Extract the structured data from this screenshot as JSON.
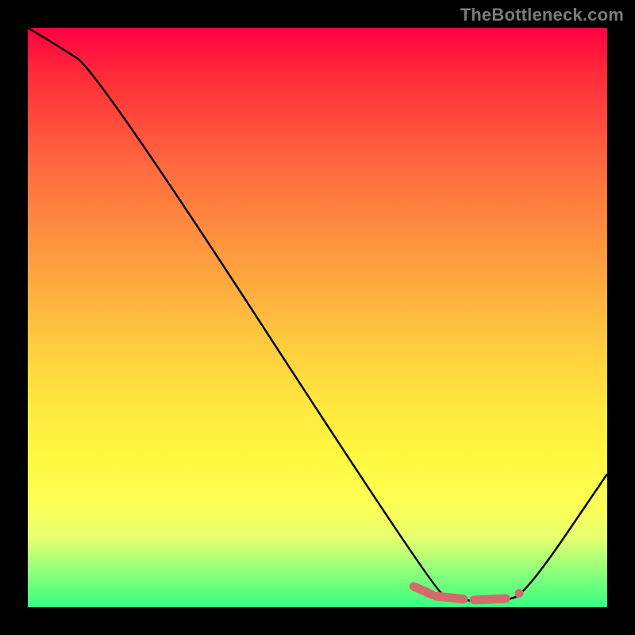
{
  "watermark": "TheBottleneck.com",
  "colors": {
    "gradient_top": "#ff0040",
    "gradient_bottom": "#36ff82",
    "curve": "#000000",
    "marker": "#d46a6a",
    "frame_bg": "#000000"
  },
  "chart_data": {
    "type": "line",
    "title": "",
    "xlabel": "",
    "ylabel": "",
    "xlim": [
      0,
      100
    ],
    "ylim": [
      0,
      100
    ],
    "series": [
      {
        "name": "bottleneck-curve",
        "x": [
          0,
          5,
          12,
          70,
          73,
          78,
          82,
          86,
          100
        ],
        "values": [
          100,
          97,
          92.5,
          3.1,
          1.6,
          0.9,
          1.0,
          2.4,
          23
        ]
      }
    ],
    "markers": [
      {
        "name": "optimal-segment-1",
        "x1": 66.6,
        "y1": 3.6,
        "x2": 69.7,
        "y2": 2.2
      },
      {
        "name": "optimal-segment-2",
        "x1": 70.5,
        "y1": 1.9,
        "x2": 75.2,
        "y2": 1.4
      },
      {
        "name": "optimal-segment-3",
        "x1": 77.0,
        "y1": 1.25,
        "x2": 82.5,
        "y2": 1.5
      },
      {
        "name": "optimal-dot",
        "x1": 84.8,
        "y1": 2.4,
        "x2": 84.8,
        "y2": 2.4
      }
    ]
  }
}
